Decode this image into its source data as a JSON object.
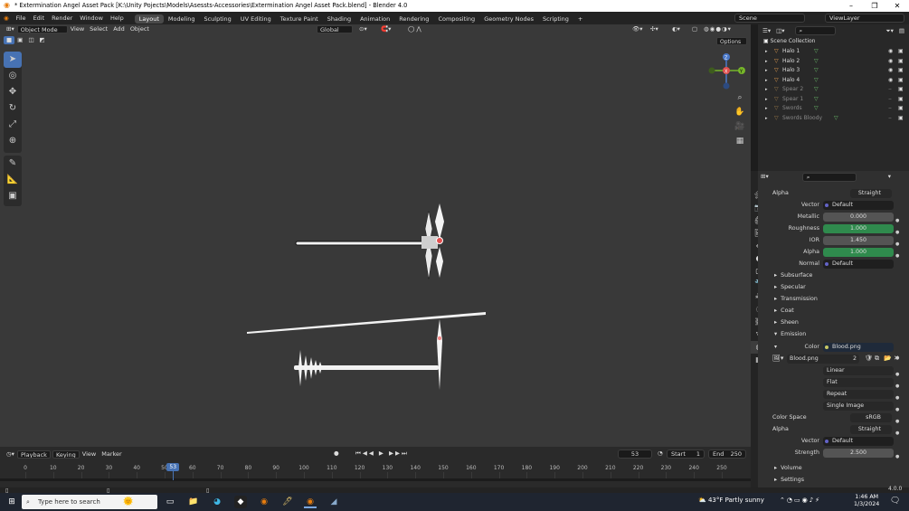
{
  "window": {
    "title": "* Extermination Angel Asset Pack [K:\\Unity Pojects\\Models\\Asessts-Accessories\\Extermination Angel Asset Pack.blend] - Blender 4.0",
    "minimize": "–",
    "maximize": "❐",
    "close": "✕"
  },
  "menus": [
    "File",
    "Edit",
    "Render",
    "Window",
    "Help"
  ],
  "workspaces": [
    "Layout",
    "Modeling",
    "Sculpting",
    "UV Editing",
    "Texture Paint",
    "Shading",
    "Animation",
    "Rendering",
    "Compositing",
    "Geometry Nodes",
    "Scripting"
  ],
  "workspace_add": "+",
  "scene": {
    "scene_name": "Scene",
    "view_layer": "ViewLayer"
  },
  "viewport_header": {
    "mode": "Object Mode",
    "view": "View",
    "select": "Select",
    "add": "Add",
    "object": "Object",
    "orientation": "Global",
    "options": "Options"
  },
  "gizmo": {
    "z": "Z",
    "y": "Y",
    "x": "X"
  },
  "outliner": {
    "root": "Scene Collection",
    "items": [
      "Halo 1",
      "Halo 2",
      "Halo 3",
      "Halo 4",
      "Spear 2",
      "Spear 1",
      "Swords",
      "Swords Bloody"
    ]
  },
  "properties": {
    "alpha_mode_label": "Alpha",
    "alpha_mode": "Straight",
    "vector_label": "Vector",
    "vector_value": "Default",
    "metallic_label": "Metallic",
    "metallic": "0.000",
    "roughness_label": "Roughness",
    "roughness": "1.000",
    "ior_label": "IOR",
    "ior": "1.450",
    "alpha_label": "Alpha",
    "alpha": "1.000",
    "normal_label": "Normal",
    "normal": "Default",
    "sections": [
      "Subsurface",
      "Specular",
      "Transmission",
      "Coat",
      "Sheen",
      "Emission"
    ],
    "color_label": "Color",
    "color_value": "Blood.png",
    "image_name": "Blood.png",
    "image_users": "2",
    "interpolation": "Linear",
    "projection": "Flat",
    "extension": "Repeat",
    "source": "Single Image",
    "color_space_label": "Color Space",
    "color_space": "sRGB",
    "alpha2_label": "Alpha",
    "alpha2": "Straight",
    "vector2_label": "Vector",
    "vector2": "Default",
    "strength_label": "Strength",
    "strength": "2.500",
    "volume": "Volume",
    "settings": "Settings"
  },
  "timeline": {
    "playback": "Playback",
    "keying": "Keying",
    "view": "View",
    "marker": "Marker",
    "current_frame": "53",
    "start_label": "Start",
    "start": "1",
    "end_label": "End",
    "end": "250",
    "playhead": "53",
    "ticks": [
      "0",
      "10",
      "20",
      "30",
      "40",
      "50",
      "60",
      "70",
      "80",
      "90",
      "100",
      "110",
      "120",
      "130",
      "140",
      "150",
      "160",
      "170",
      "180",
      "190",
      "200",
      "210",
      "220",
      "230",
      "240",
      "250"
    ]
  },
  "status": {
    "version": "4.0.0"
  },
  "taskbar": {
    "search_placeholder": "Type here to search",
    "weather": "43°F  Partly sunny",
    "time": "1:46 AM",
    "date": "1/3/2024"
  },
  "colors": {
    "accent": "#4772b3",
    "green": "#2f8a4d",
    "viewport": "#393939"
  }
}
